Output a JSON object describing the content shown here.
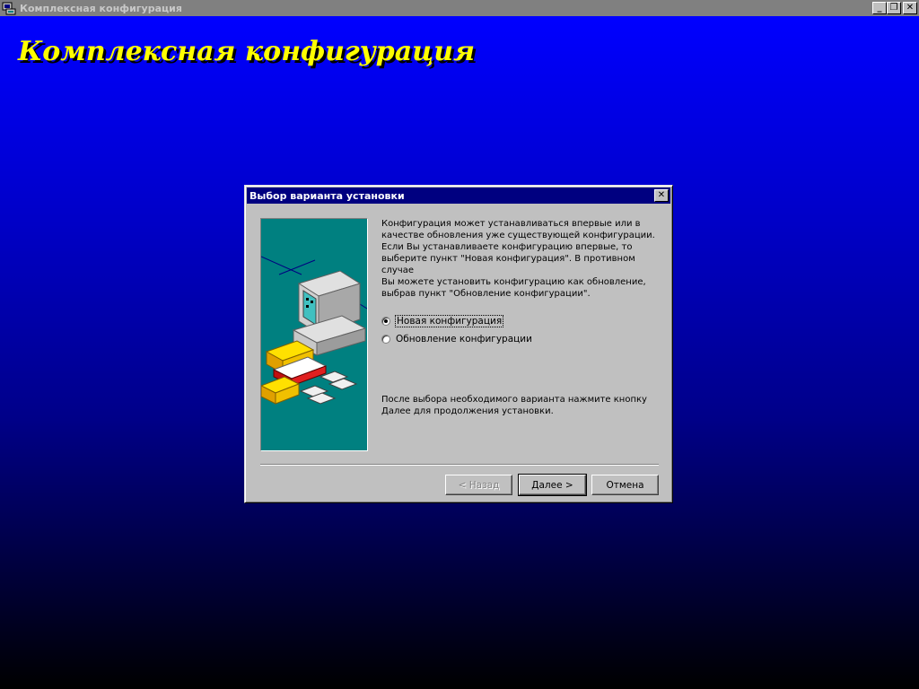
{
  "window": {
    "title": "Комплексная конфигурация",
    "controls": {
      "minimize": "_",
      "restore": "❐",
      "close": "✕"
    }
  },
  "setup": {
    "title": "Комплексная конфигурация"
  },
  "dialog": {
    "title": "Выбор варианта установки",
    "close_glyph": "✕",
    "intro": "Конфигурация может устанавливаться впервые или в\nкачестве обновления уже существующей конфигурации.\nЕсли Вы устанавливаете конфигурацию впервые, то\nвыберите пункт \"Новая конфигурация\". В противном случае\nВы можете установить конфигурацию как обновление,\nвыбрав пункт \"Обновление конфигурации\".",
    "options": [
      {
        "label": "Новая конфигурация",
        "checked": true
      },
      {
        "label": "Обновление конфигурации",
        "checked": false
      }
    ],
    "hint": "После выбора необходимого варианта нажмите кнопку\nДалее для продолжения установки.",
    "buttons": {
      "back": "< Назад",
      "next": "Далее >",
      "cancel": "Отмена"
    }
  },
  "colors": {
    "titlebar_active": "#000080",
    "setup_title": "#ffff00",
    "image_bg": "#008080",
    "face": "#c0c0c0"
  }
}
